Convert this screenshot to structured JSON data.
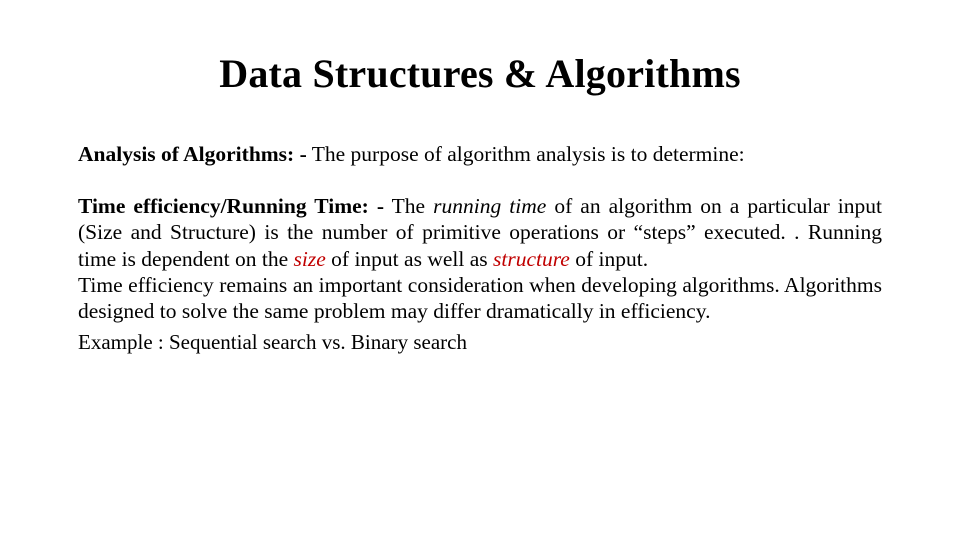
{
  "title": "Data Structures & Algorithms",
  "p1_lead_bold": "Analysis of Algorithms: -",
  "p1_rest": " The purpose of algorithm analysis is to determine:",
  "p2_lead_bold": "Time efficiency/Running Time: -",
  "p2_a": " The ",
  "p2_running_time": "running time",
  "p2_b": " of an algorithm on a particular input (Size and Structure) is the number of primitive operations or “steps” executed. . Running time is dependent on the ",
  "p2_size": "size",
  "p2_c": " of input as well as ",
  "p2_structure": "structure",
  "p2_d": " of input.",
  "p2_line2": "Time efficiency remains an important consideration when developing algorithms. Algorithms designed to solve the same problem may differ dramatically in efficiency.",
  "example": "Example : Sequential search vs. Binary search"
}
